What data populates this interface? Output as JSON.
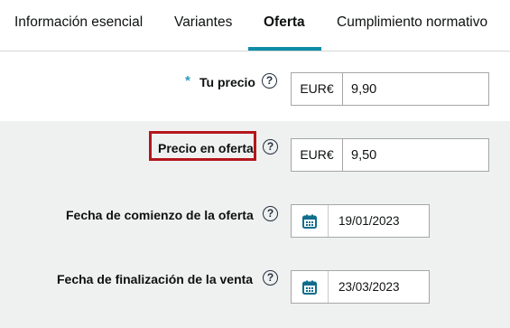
{
  "tabs": [
    {
      "label": "Información esencial"
    },
    {
      "label": "Variantes"
    },
    {
      "label": "Oferta"
    },
    {
      "label": "Cumplimiento normativo"
    }
  ],
  "fields": {
    "price": {
      "required_mark": "*",
      "label": "Tu precio",
      "help": "?",
      "currency": "EUR€",
      "value": "9,90"
    },
    "sale_price": {
      "label": "Precio en oferta",
      "help": "?",
      "currency": "EUR€",
      "value": "9,50"
    },
    "sale_start": {
      "label": "Fecha de comienzo de la oferta",
      "help": "?",
      "icon": "calendar-icon",
      "value": "19/01/2023"
    },
    "sale_end": {
      "label": "Fecha de finalización de la venta",
      "help": "?",
      "icon": "calendar-icon",
      "value": "23/03/2023"
    }
  },
  "colors": {
    "active_tab_underline": "#0f8ca8",
    "highlight_border": "#b4161b",
    "required_asterisk": "#2a9fb8",
    "calendar_icon": "#0f6e8c",
    "gray_section": "#eff1f1"
  }
}
